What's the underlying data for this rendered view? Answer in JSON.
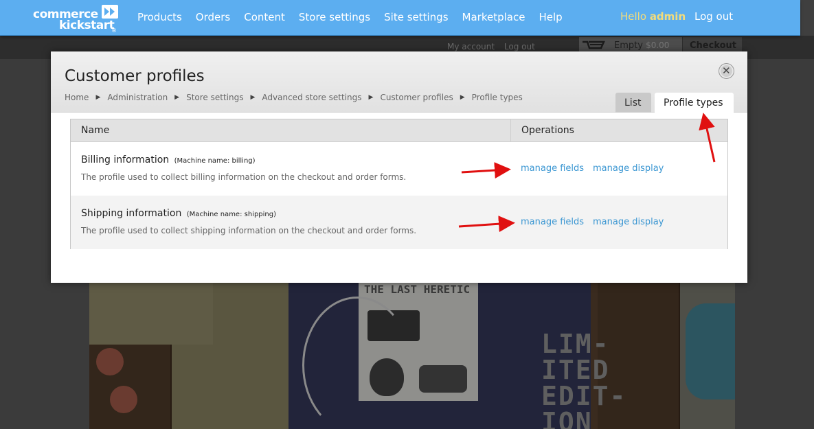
{
  "toolbar": {
    "logo_line1": "commerce",
    "logo_line2": "kickstart",
    "logo_tm": "®",
    "nav": [
      "Products",
      "Orders",
      "Content",
      "Store settings",
      "Site settings",
      "Marketplace",
      "Help"
    ],
    "hello_prefix": "Hello",
    "username": "admin",
    "logout": "Log out",
    "colors": {
      "bar": "#5caef0",
      "hello": "#f3dc7a"
    }
  },
  "background_page": {
    "my_account": "My account",
    "log_out": "Log out",
    "cart_empty": "Empty",
    "cart_total": "$0.00",
    "checkout": "Checkout",
    "banner_text": [
      "LIM-",
      "ITED",
      "EDIT-",
      "ION"
    ],
    "print_title": "THE LAST HERETIC"
  },
  "modal": {
    "title": "Customer profiles",
    "close_icon": "close-icon",
    "breadcrumb": [
      "Home",
      "Administration",
      "Store settings",
      "Advanced store settings",
      "Customer profiles",
      "Profile types"
    ],
    "tabs": [
      {
        "label": "List",
        "active": false
      },
      {
        "label": "Profile types",
        "active": true
      }
    ],
    "table": {
      "headers": [
        "Name",
        "Operations"
      ],
      "rows": [
        {
          "name": "Billing information",
          "machine": "(Machine name: billing)",
          "description": "The profile used to collect billing information on the checkout and order forms.",
          "ops": [
            "manage fields",
            "manage display"
          ]
        },
        {
          "name": "Shipping information",
          "machine": "(Machine name: shipping)",
          "description": "The profile used to collect shipping information on the checkout and order forms.",
          "ops": [
            "manage fields",
            "manage display"
          ]
        }
      ]
    },
    "link_color": "#3a96d2",
    "annotation_color": "#e01010"
  }
}
